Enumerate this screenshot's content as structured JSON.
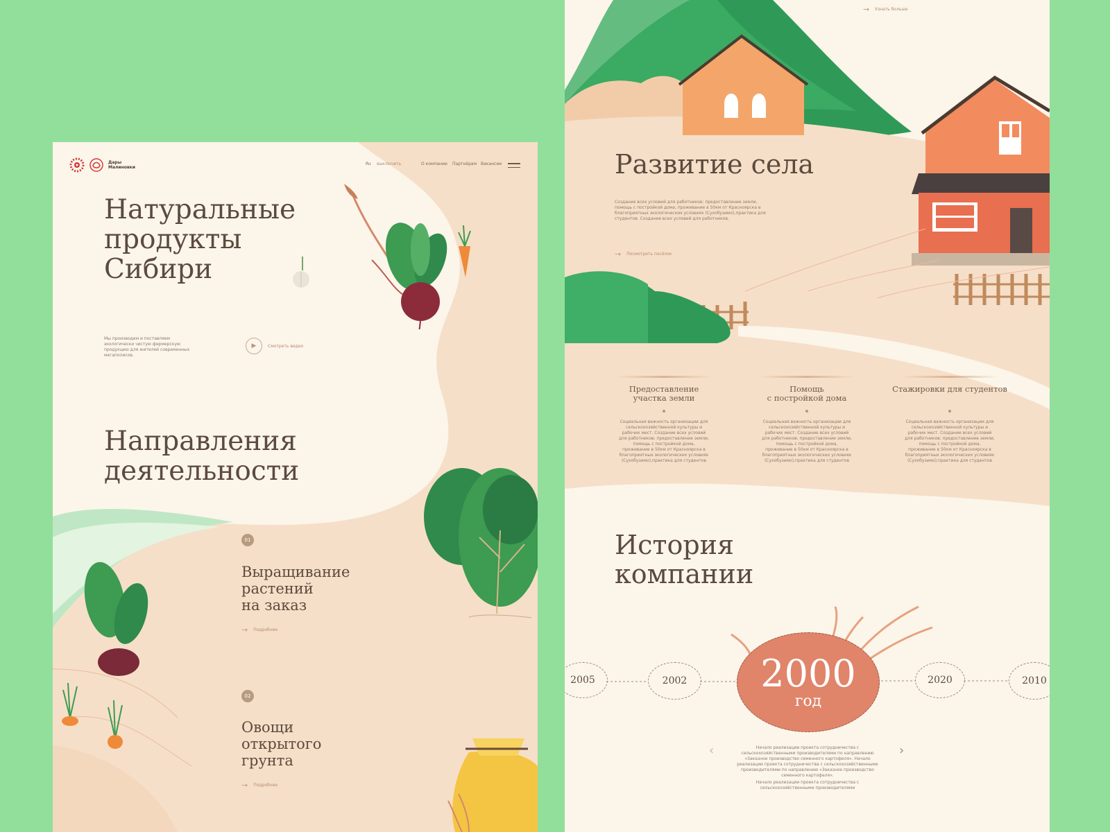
{
  "header": {
    "logo_text": "Дары Малиновки",
    "lang": "Ru",
    "phone_link": "выключить",
    "nav_items": [
      "О компании",
      "Партнёрам",
      "Вакансии"
    ]
  },
  "hero": {
    "title_line1": "Натуральные",
    "title_line2": "продукты",
    "title_line3": "Сибири",
    "description": "Мы производим и поставляем экологически чистую фермерскую продукцию для жителей современных мегаполисов.",
    "video_link": "Смотреть видео"
  },
  "directions": {
    "title_line1": "Направления",
    "title_line2": "деятельности",
    "items": [
      {
        "num": "01",
        "title_line1": "Выращивание",
        "title_line2": "растений",
        "title_line3": "на заказ",
        "link": "Подробнее"
      },
      {
        "num": "02",
        "title_line1": "Овощи",
        "title_line2": "открытого",
        "title_line3": "грунта",
        "link": "Подробнее"
      }
    ]
  },
  "village": {
    "top_link": "Узнать больше",
    "title": "Развитие села",
    "description": "Создание всех условий для работников: предоставление земли, помощь с постройкой дома, проживание в 50км от Красноярска в благоприятных экологических условиях (Сухобузимо),практика для студентов. Создание всех условий для работников.",
    "link": "Посмотреть посёлок",
    "columns": [
      {
        "title_line1": "Предоставление",
        "title_line2": "участка земли",
        "text": "Социальная важность организации для сельскохозяйственной культуры и рабочих мест. Создание всех условий для работников: предоставление земли, помощь с постройкой дома, проживание в 50км от Красноярска в благоприятных экологических условиях (Сухобузимо),практика для студентов"
      },
      {
        "title_line1": "Помощь",
        "title_line2": "с постройкой дома",
        "text": "Социальная важность организации для сельскохозяйственной культуры и рабочих мест. Создание всех условий для работников: предоставление земли, помощь с постройкой дома, проживание в 50км от Красноярска в благоприятных экологических условиях (Сухобузимо),практика для студентов"
      },
      {
        "title_line1": "Стажировки для студентов",
        "title_line2": "",
        "text": "Социальная важность организации для сельскохозяйственной культуры и рабочих мест. Создание всех условий для работников: предоставление земли, помощь с постройкой дома, проживание в 50км от Красноярска в благоприятных экологических условиях (Сухобузимо),практика для студентов"
      }
    ]
  },
  "history": {
    "title_line1": "История",
    "title_line2": "компании",
    "years": [
      "2005",
      "2002",
      "2020",
      "2010"
    ],
    "current_year": "2000",
    "current_label": "год",
    "text1": "Начало реализации проекта сотрудничества с сельскохозяйственными производителями по направлению «Заказное производство семенного картофеля». Начало реализации проекта сотрудничества с сельскохозяйственными производителями по направлению «Заказное производство семенного картофеля».",
    "text2": "Начало реализации проекта сотрудничества с сельскохозяйственными производителями",
    "prev_arrow": "‹",
    "next_arrow": "›"
  },
  "colors": {
    "background": "#92df9c",
    "page": "#fcf5ea",
    "sand": "#f6dfc8",
    "green": "#2f8a4c",
    "house": "#ee8a5c",
    "accent": "#e0846a"
  }
}
